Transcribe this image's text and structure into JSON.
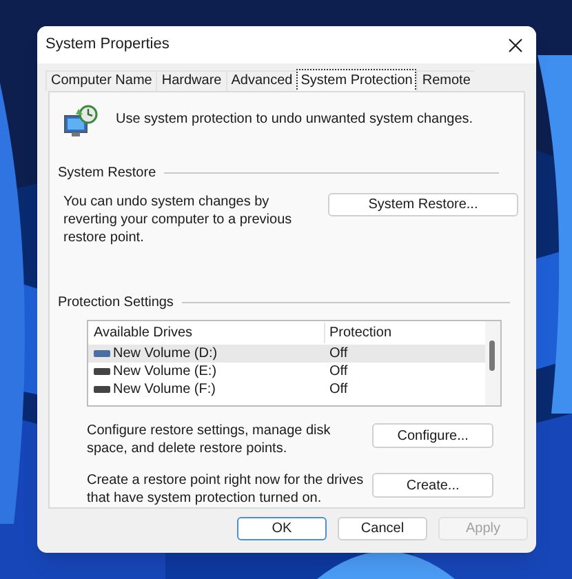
{
  "window": {
    "title": "System Properties"
  },
  "tabs": [
    {
      "label": "Computer Name",
      "selected": false
    },
    {
      "label": "Hardware",
      "selected": false
    },
    {
      "label": "Advanced",
      "selected": false
    },
    {
      "label": "System Protection",
      "selected": true
    },
    {
      "label": "Remote",
      "selected": false
    }
  ],
  "intro": "Use system protection to undo unwanted system changes.",
  "system_restore": {
    "heading": "System Restore",
    "text": "You can undo system changes by reverting your computer to a previous restore point.",
    "button": "System Restore..."
  },
  "protection_settings": {
    "heading": "Protection Settings",
    "columns": [
      "Available Drives",
      "Protection"
    ],
    "rows": [
      {
        "drive": "New Volume (D:)",
        "protection": "Off",
        "selected": true
      },
      {
        "drive": "New Volume (E:)",
        "protection": "Off",
        "selected": false
      },
      {
        "drive": "New Volume (F:)",
        "protection": "Off",
        "selected": false
      }
    ],
    "actions": [
      {
        "text": "Configure restore settings, manage disk space, and delete restore points.",
        "button": "Configure..."
      },
      {
        "text": "Create a restore point right now for the drives that have system protection turned on.",
        "button": "Create..."
      }
    ]
  },
  "buttons": [
    {
      "label": "OK",
      "default": true,
      "disabled": false
    },
    {
      "label": "Cancel",
      "default": false,
      "disabled": false
    },
    {
      "label": "Apply",
      "default": false,
      "disabled": true
    }
  ]
}
